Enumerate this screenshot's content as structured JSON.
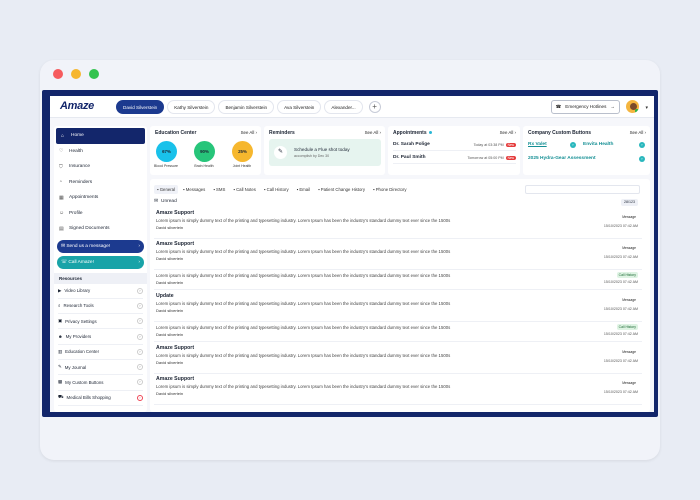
{
  "app": {
    "logo": "Amaze",
    "patient_tabs": [
      "David Silverstein",
      "Kathy Silverstein",
      "Benjamin Silverstein",
      "Ava Silverstein",
      "Alexander..."
    ],
    "add_tab": "+",
    "emergency_button": "Emergency Hotlines"
  },
  "sidebar": {
    "nav": [
      {
        "label": "Home",
        "icon": "home-icon"
      },
      {
        "label": "Health",
        "icon": "heart-icon"
      },
      {
        "label": "Insurance",
        "icon": "shield-icon"
      },
      {
        "label": "Reminders",
        "icon": "bell-icon"
      },
      {
        "label": "Appointments",
        "icon": "calendar-icon"
      },
      {
        "label": "Profile",
        "icon": "user-icon"
      },
      {
        "label": "Signed Documents",
        "icon": "document-icon"
      }
    ],
    "send_message": "Send us a message!",
    "call": "Call Amaze!",
    "resources_title": "Resources",
    "resources": [
      "Video Library",
      "Research Tools",
      "Privacy Settings",
      "My Providers",
      "Education Center",
      "My Journal",
      "My Custom Buttons",
      "Medical Bills Shopping"
    ]
  },
  "education": {
    "title": "Education Center",
    "see_all": "See All",
    "items": [
      {
        "value": "67%",
        "label": "Blood Pressure",
        "color": "#19c1ea"
      },
      {
        "value": "90%",
        "label": "Brain Health",
        "color": "#27c57a"
      },
      {
        "value": "25%",
        "label": "Joint Health",
        "color": "#f6b72e"
      }
    ]
  },
  "reminders": {
    "title": "Reminders",
    "see_all": "See All",
    "item_title": "Schedule a Flue shot today",
    "item_sub": "accomplish by Dec 30"
  },
  "appointments": {
    "title": "Appointments",
    "see_all": "See All",
    "items": [
      {
        "name": "Dr. Sarah Polige",
        "when": "Today at 03:38 PM",
        "badge": "New"
      },
      {
        "name": "Dr. Paul Smith",
        "when": "Tomorrow at 05:00 PM",
        "badge": "New"
      }
    ]
  },
  "custom_buttons": {
    "title": "Company Custom Buttons",
    "see_all": "See All",
    "items": [
      "Rx Valet",
      "Envita Health",
      "2025 Hydra-Gear Assessment"
    ]
  },
  "messages": {
    "filters": [
      "General",
      "Messages",
      "SMS",
      "Call Notes",
      "Call History",
      "Email",
      "Patient Change History",
      "Phone Directory"
    ],
    "unread_label": "Unread",
    "counter": "28/123",
    "items": [
      {
        "title": "Amaze Support",
        "body": "Lorem ipsum is simply dummy text of the printing and typesetting industry. Lorem Ipsum has been the industry's standard dummy text ever since the 1500s",
        "sender": "David silvertein",
        "date": "15/10/2023 07:42 AM",
        "badge": "Message",
        "badge_style": "plain"
      },
      {
        "title": "Amaze Support",
        "body": "Lorem ipsum is simply dummy text of the printing and typesetting industry. Lorem Ipsum has been the industry's standard dummy text ever since the 1500s",
        "sender": "David silvertein",
        "date": "15/10/2023 07:42 AM",
        "badge": "Message",
        "badge_style": "plain"
      },
      {
        "title": "",
        "body": "Lorem ipsum is simply dummy text of the printing and typesetting industry. Lorem Ipsum has been the industry's standard dummy text ever since the 1500s",
        "sender": "David silvertein",
        "date": "15/10/2023 07:42 AM",
        "badge": "Call History",
        "badge_style": "green"
      },
      {
        "title": "Update",
        "body": "Lorem ipsum is simply dummy text of the printing and typesetting industry. Lorem Ipsum has been the industry's standard dummy text ever since the 1500s",
        "sender": "David silvertein",
        "date": "15/10/2023 07:42 AM",
        "badge": "Message",
        "badge_style": "plain"
      },
      {
        "title": "",
        "body": "Lorem ipsum is simply dummy text of the printing and typesetting industry. Lorem Ipsum has been the industry's standard dummy text ever since the 1500s",
        "sender": "David silvertein",
        "date": "15/10/2023 07:42 AM",
        "badge": "Call History",
        "badge_style": "green"
      },
      {
        "title": "Amaze Support",
        "body": "Lorem ipsum is simply dummy text of the printing and typesetting industry. Lorem Ipsum has been the industry's standard dummy text ever since the 1500s",
        "sender": "David silvertein",
        "date": "15/10/2023 07:42 AM",
        "badge": "Message",
        "badge_style": "plain"
      },
      {
        "title": "Amaze Support",
        "body": "Lorem ipsum is simply dummy text of the printing and typesetting industry. Lorem Ipsum has been the industry's standard dummy text ever since the 1500s",
        "sender": "David silvertein",
        "date": "15/10/2023 07:42 AM",
        "badge": "Message",
        "badge_style": "plain"
      }
    ]
  }
}
